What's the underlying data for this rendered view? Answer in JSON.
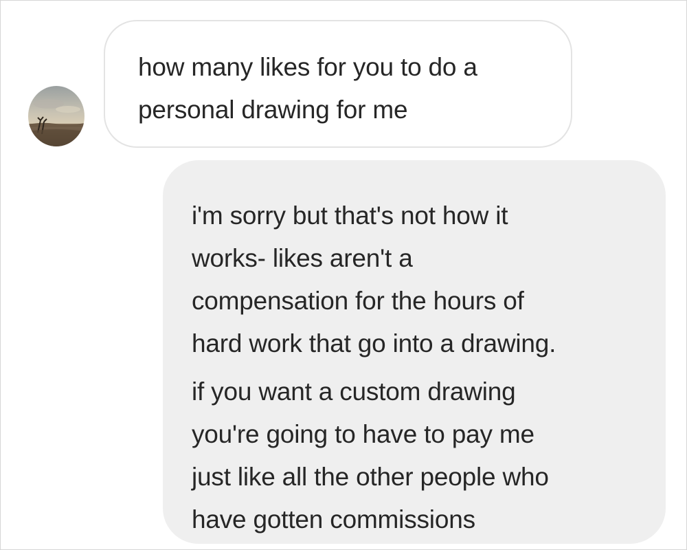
{
  "conversation": {
    "incoming": {
      "avatar_icon": "user-avatar-photo",
      "lines": [
        "how many likes for you to do a",
        "personal drawing for me"
      ]
    },
    "outgoing": {
      "paragraphs": [
        {
          "lines": [
            "i'm sorry but that's not how it",
            "works- likes aren't a",
            "compensation for the hours of",
            "hard work that go into a drawing."
          ]
        },
        {
          "lines": [
            "if you want a custom drawing",
            "you're going to have to pay me",
            "just like all the other people who",
            "have gotten commissions"
          ]
        }
      ]
    }
  },
  "colors": {
    "incoming_bubble_border": "#e3e3e3",
    "outgoing_bubble_bg": "#efefef",
    "text": "#262626"
  }
}
